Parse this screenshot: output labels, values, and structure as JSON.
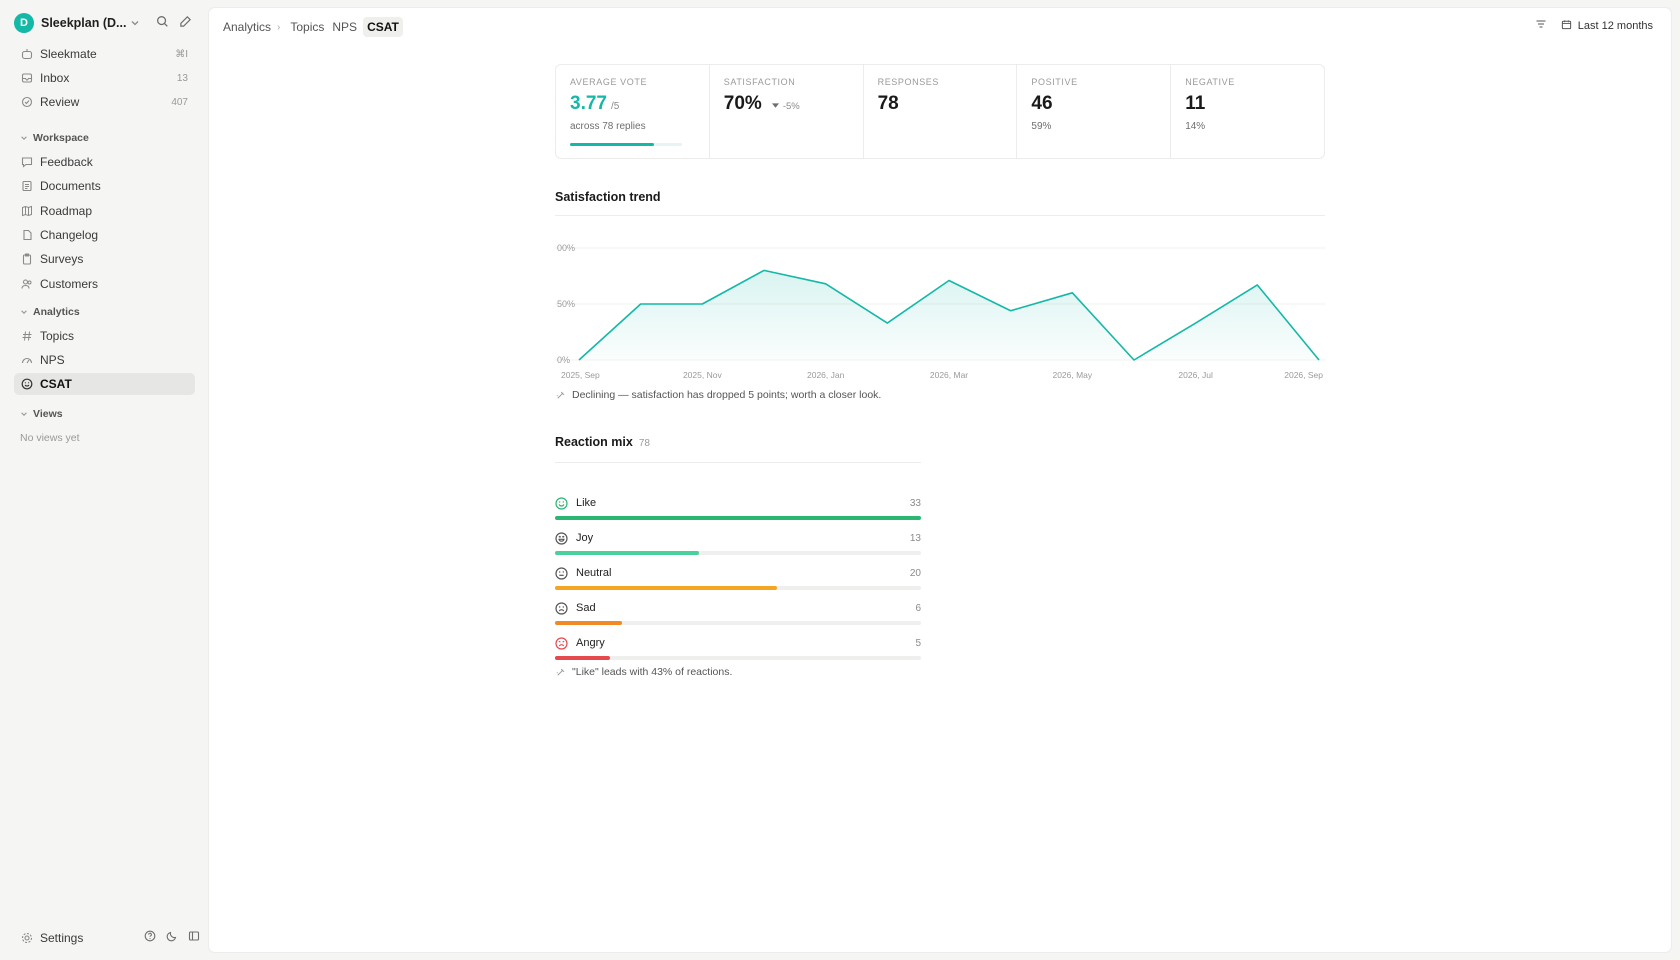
{
  "workspace": {
    "initial": "D",
    "name": "Sleekplan (D..."
  },
  "sidebar": {
    "top_items": [
      {
        "label": "Sleekmate",
        "count": "⌘I"
      },
      {
        "label": "Inbox",
        "count": "13"
      },
      {
        "label": "Review",
        "count": "407"
      }
    ],
    "workspace_section": "Workspace",
    "workspace_items": [
      {
        "label": "Feedback"
      },
      {
        "label": "Documents"
      },
      {
        "label": "Roadmap"
      },
      {
        "label": "Changelog"
      },
      {
        "label": "Surveys"
      },
      {
        "label": "Customers"
      }
    ],
    "analytics_section": "Analytics",
    "analytics_items": [
      {
        "label": "Topics"
      },
      {
        "label": "NPS"
      },
      {
        "label": "CSAT"
      }
    ],
    "views_section": "Views",
    "no_views": "No views yet",
    "settings": "Settings"
  },
  "breadcrumb": {
    "root": "Analytics",
    "items": [
      "Topics",
      "NPS",
      "CSAT"
    ]
  },
  "header": {
    "date_range": "Last 12 months"
  },
  "kpis": {
    "average_vote": {
      "label": "AVERAGE VOTE",
      "value": "3.77",
      "suffix": "/5",
      "sub": "across 78 replies",
      "progress": 0.754
    },
    "satisfaction": {
      "label": "SATISFACTION",
      "value": "70%",
      "delta": "-5%"
    },
    "responses": {
      "label": "RESPONSES",
      "value": "78"
    },
    "positive": {
      "label": "POSITIVE",
      "value": "46",
      "sub": "59%"
    },
    "negative": {
      "label": "NEGATIVE",
      "value": "11",
      "sub": "14%"
    }
  },
  "trend": {
    "title": "Satisfaction trend",
    "note": "Declining — satisfaction has dropped 5 points; worth a closer look."
  },
  "chart_data": {
    "type": "area",
    "title": "Satisfaction trend",
    "y_ticks": [
      "00%",
      "50%",
      "0%"
    ],
    "ylim": [
      0,
      100
    ],
    "x_ticks": [
      "2025, Sep",
      "2025, Nov",
      "2026, Jan",
      "2026, Mar",
      "2026, May",
      "2026, Jul",
      "2026, Sep"
    ],
    "x": [
      "2025, Sep",
      "2025, Oct",
      "2025, Nov",
      "2025, Dec",
      "2026, Jan",
      "2026, Feb",
      "2026, Mar",
      "2026, Apr",
      "2026, May",
      "2026, Jun",
      "2026, Jul",
      "2026, Aug",
      "2026, Sep"
    ],
    "values": [
      0,
      50,
      50,
      80,
      68,
      33,
      71,
      44,
      60,
      0,
      33,
      67,
      0
    ],
    "color": "#14b8a6"
  },
  "reactions": {
    "title": "Reaction mix",
    "total": "78",
    "items": [
      {
        "label": "Like",
        "count": "33",
        "value": 33,
        "color": "#2bb673",
        "icon": "smile-icon"
      },
      {
        "label": "Joy",
        "count": "13",
        "value": 13,
        "color": "#4cd09b",
        "icon": "joy-icon"
      },
      {
        "label": "Neutral",
        "count": "20",
        "value": 20,
        "color": "#f5a524",
        "icon": "neutral-face-icon"
      },
      {
        "label": "Sad",
        "count": "6",
        "value": 6,
        "color": "#f08a24",
        "icon": "sad-face-icon"
      },
      {
        "label": "Angry",
        "count": "5",
        "value": 5,
        "color": "#e5484d",
        "icon": "angry-face-icon"
      }
    ],
    "max": 33,
    "note": "\"Like\" leads with 43% of reactions."
  }
}
